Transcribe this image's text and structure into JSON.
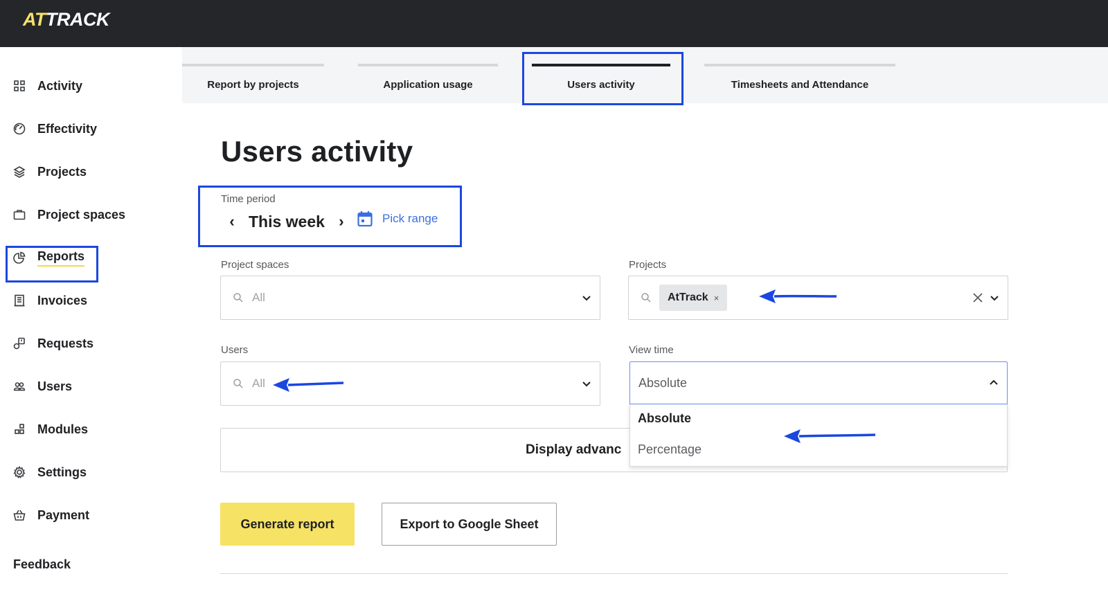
{
  "app": {
    "logo_accent": "AT",
    "logo_rest": "TRACK"
  },
  "colors": {
    "topbar": "#24262a",
    "accent_yellow": "#f6e264",
    "link_blue": "#3b6fe0",
    "highlight_blue": "#1a47e0"
  },
  "sidebar": {
    "items": [
      {
        "label": "Activity",
        "icon": "grid-icon"
      },
      {
        "label": "Effectivity",
        "icon": "gauge-icon"
      },
      {
        "label": "Projects",
        "icon": "layers-icon"
      },
      {
        "label": "Project spaces",
        "icon": "briefcase-icon"
      },
      {
        "label": "Reports",
        "icon": "pie-chart-icon",
        "active": true
      },
      {
        "label": "Invoices",
        "icon": "invoice-icon"
      },
      {
        "label": "Requests",
        "icon": "request-icon"
      },
      {
        "label": "Users",
        "icon": "users-icon"
      },
      {
        "label": "Modules",
        "icon": "modules-icon"
      },
      {
        "label": "Settings",
        "icon": "gear-icon"
      },
      {
        "label": "Payment",
        "icon": "basket-icon"
      }
    ],
    "feedback": "Feedback"
  },
  "tabs": [
    {
      "label": "Report by projects"
    },
    {
      "label": "Application usage"
    },
    {
      "label": "Users activity",
      "active": true
    },
    {
      "label": "Timesheets and Attendance"
    }
  ],
  "main": {
    "title": "Users activity",
    "time_period": {
      "label": "Time period",
      "value": "This week",
      "pick_range": "Pick range"
    },
    "project_spaces": {
      "label": "Project spaces",
      "placeholder": "All"
    },
    "projects": {
      "label": "Projects",
      "chip": "AtTrack",
      "chip_remove": "×"
    },
    "users": {
      "label": "Users",
      "placeholder": "All"
    },
    "view_time": {
      "label": "View time",
      "value": "Absolute",
      "options": [
        "Absolute",
        "Percentage"
      ]
    },
    "advanced_button": "Display advanc",
    "generate_button": "Generate report",
    "export_button": "Export to Google Sheet"
  }
}
